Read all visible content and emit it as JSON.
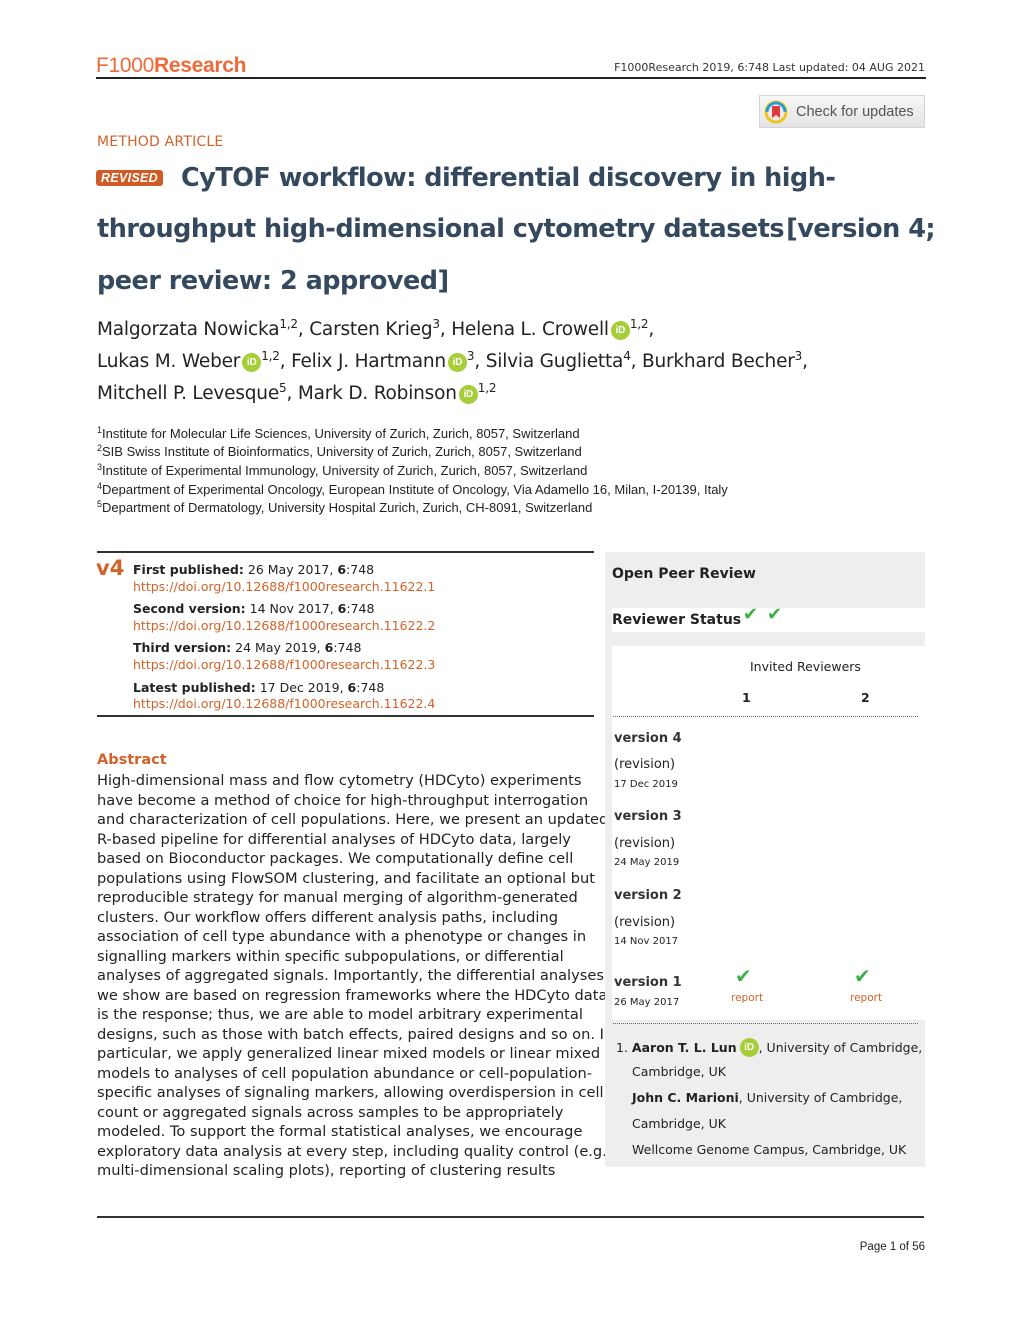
{
  "header": {
    "logo_left": "F1000",
    "logo_right": "Research",
    "citation": "F1000Research 2019, 6:748 Last updated: 04 AUG 2021",
    "check_updates_label": "Check for updates",
    "check_updates_icon": "crossmark-icon"
  },
  "article": {
    "type": "METHOD ARTICLE",
    "badge": "REVISED",
    "title_line1": "CyTOF workflow: differential discovery in high-",
    "title_line2": "throughput high-dimensional cytometry datasets",
    "title_version_a": "[version 4;",
    "title_line3": "peer review: 2 approved]"
  },
  "authors": [
    {
      "name": "Malgorzata Nowicka",
      "aff": "1,2",
      "orcid": false
    },
    {
      "name": "Carsten Krieg",
      "aff": "3",
      "orcid": false
    },
    {
      "name": "Helena L. Crowell",
      "aff": "1,2",
      "orcid": true
    },
    {
      "name": "Lukas M. Weber",
      "aff": "1,2",
      "orcid": true
    },
    {
      "name": "Felix J. Hartmann",
      "aff": "3",
      "orcid": true
    },
    {
      "name": "Silvia Guglietta",
      "aff": "4",
      "orcid": false
    },
    {
      "name": "Burkhard Becher",
      "aff": "3",
      "orcid": false
    },
    {
      "name": "Mitchell P. Levesque",
      "aff": "5",
      "orcid": false
    },
    {
      "name": "Mark D. Robinson",
      "aff": "1,2",
      "orcid": true
    }
  ],
  "orcid_label": "iD",
  "affiliations": [
    {
      "num": "1",
      "text": "Institute for Molecular Life Sciences, University of Zurich, Zurich, 8057, Switzerland"
    },
    {
      "num": "2",
      "text": "SIB Swiss Institute of Bioinformatics, University of Zurich, Zurich, 8057, Switzerland"
    },
    {
      "num": "3",
      "text": "Institute of Experimental Immunology, University of Zurich, Zurich, 8057, Switzerland"
    },
    {
      "num": "4",
      "text": "Department of Experimental Oncology, European Institute of Oncology, Via Adamello 16, Milan, I-20139, Italy"
    },
    {
      "num": "5",
      "text": "Department of Dermatology, University Hospital Zurich, Zurich, CH-8091, Switzerland"
    }
  ],
  "versions": {
    "badge": "v4",
    "items": [
      {
        "label": "First published:",
        "date": " 26 May 2017, ",
        "vol": "6",
        "page": ":748",
        "doi": "https://doi.org/10.12688/f1000research.11622.1"
      },
      {
        "label": "Second version:",
        "date": " 14 Nov 2017, ",
        "vol": "6",
        "page": ":748",
        "doi": "https://doi.org/10.12688/f1000research.11622.2"
      },
      {
        "label": "Third version:",
        "date": " 24 May 2019, ",
        "vol": "6",
        "page": ":748",
        "doi": "https://doi.org/10.12688/f1000research.11622.3"
      },
      {
        "label": "Latest published:",
        "date": " 17 Dec 2019, ",
        "vol": "6",
        "page": ":748",
        "doi": "https://doi.org/10.12688/f1000research.11622.4"
      }
    ]
  },
  "abstract": {
    "heading": "Abstract",
    "lines": [
      "High-dimensional mass and flow cytometry (HDCyto) experiments",
      "have become a method of choice for high-throughput interrogation",
      "and characterization of cell populations. Here, we present an updated",
      "R-based pipeline for differential analyses of HDCyto data, largely",
      "based on Bioconductor packages. We computationally define cell",
      "populations using FlowSOM clustering, and facilitate an optional but",
      "reproducible strategy for manual merging of algorithm-generated",
      "clusters. Our workflow offers different analysis paths, including",
      "association of cell type abundance with a phenotype or changes in",
      "signalling markers within specific subpopulations, or differential",
      "analyses of aggregated signals. Importantly, the differential analyses",
      "we show are based on regression frameworks where the HDCyto data",
      "is the response; thus, we are able to model arbitrary experimental",
      "designs, such as those with batch effects, paired designs and so on. In",
      "particular, we apply generalized linear mixed models or linear mixed",
      "models to analyses of cell population abundance or cell-population-",
      "specific analyses of signaling markers, allowing overdispersion in cell",
      "count or aggregated signals across samples to be appropriately",
      "modeled. To support the formal statistical analyses, we encourage",
      "exploratory data analysis at every step, including quality control (e.g.,",
      "multi-dimensional scaling plots), reporting of clustering results"
    ]
  },
  "peer_review": {
    "title": "Open Peer Review",
    "status_label": "Reviewer Status",
    "status_icons": [
      "check-icon",
      "check-icon"
    ],
    "invited_label": "Invited Reviewers",
    "reviewer_numbers": [
      "1",
      "2"
    ],
    "versions": [
      {
        "label": "version 4",
        "note": "(revision)",
        "date": "17 Dec 2019",
        "reports": []
      },
      {
        "label": "version 3",
        "note": "(revision)",
        "date": "24 May 2019",
        "reports": []
      },
      {
        "label": "version 2",
        "note": "(revision)",
        "date": "14 Nov 2017",
        "reports": []
      },
      {
        "label": "version 1",
        "note": "",
        "date": "26 May 2017",
        "reports": [
          {
            "status": "approved",
            "link": "report"
          },
          {
            "status": "approved",
            "link": "report"
          }
        ]
      }
    ],
    "reviewers": [
      {
        "num": "1.",
        "name": "Aaron T. L. Lun",
        "orcid": true,
        "aff_a": ", University of Cambridge,",
        "aff_b": "Cambridge, UK"
      },
      {
        "num": "",
        "name": "John C. Marioni",
        "orcid": false,
        "aff_a": ", University of Cambridge,",
        "aff_b": "Cambridge, UK",
        "aff_c": "Wellcome Genome Campus, Cambridge, UK"
      }
    ]
  },
  "footer": {
    "page": "Page 1 of 56"
  }
}
